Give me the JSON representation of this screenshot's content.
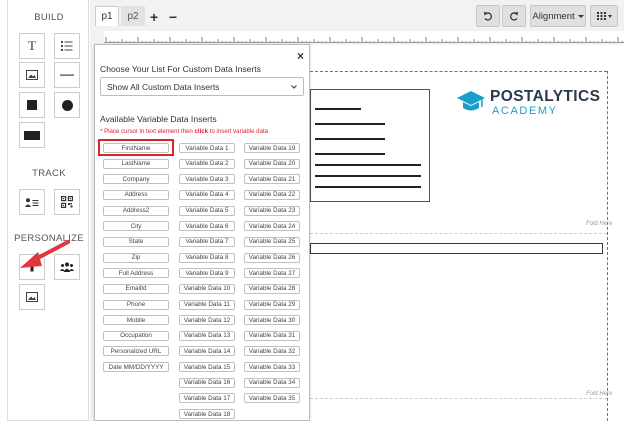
{
  "sidebar": {
    "build_title": "BUILD",
    "track_title": "TRACK",
    "personalize_title": "PERSONALIZE"
  },
  "tabs": [
    {
      "label": "p1"
    },
    {
      "label": "p2"
    }
  ],
  "toolbar": {
    "add": "+",
    "remove": "−",
    "alignment": "Alignment"
  },
  "panel": {
    "close": "×",
    "list_heading": "Choose Your List For Custom Data Inserts",
    "list_select_value": "Show All Custom Data Inserts",
    "available_heading": "Available Variable Data Inserts",
    "hint_prefix": "* Place cursor in text element then ",
    "hint_click": "click",
    "hint_suffix": " to insert variable data",
    "col1": [
      "FirstName",
      "LastName",
      "Company",
      "Address",
      "Address2",
      "City",
      "State",
      "Zip",
      "Full Address",
      "EmailId",
      "Phone",
      "Mobile",
      "Occupation",
      "Personalized URL",
      "Date MM/DD/YYYY"
    ],
    "col2": [
      "Variable Data 1",
      "Variable Data 2",
      "Variable Data 3",
      "Variable Data 4",
      "Variable Data 5",
      "Variable Data 6",
      "Variable Data 7",
      "Variable Data 8",
      "Variable Data 9",
      "Variable Data 10",
      "Variable Data 11",
      "Variable Data 12",
      "Variable Data 13",
      "Variable Data 14",
      "Variable Data 15",
      "Variable Data 16",
      "Variable Data 17",
      "Variable Data 18"
    ],
    "col3": [
      "Variable Data 19",
      "Variable Data 20",
      "Variable Data 21",
      "Variable Data 22",
      "Variable Data 23",
      "Variable Data 24",
      "Variable Data 25",
      "Variable Data 26",
      "Variable Data 27",
      "Variable Data 28",
      "Variable Data 29",
      "Variable Data 30",
      "Variable Data 31",
      "Variable Data 32",
      "Variable Data 33",
      "Variable Data 34",
      "Variable Data 35"
    ]
  },
  "logo": {
    "name": "POSTALYTICS",
    "sub": "ACADEMY"
  },
  "page": {
    "fold_label": "Fold Here"
  },
  "colors": {
    "highlight": "#d9232d",
    "accent": "#1aa0c8",
    "logo_dark": "#2b3a4a",
    "guide": "#3a9a3a"
  }
}
